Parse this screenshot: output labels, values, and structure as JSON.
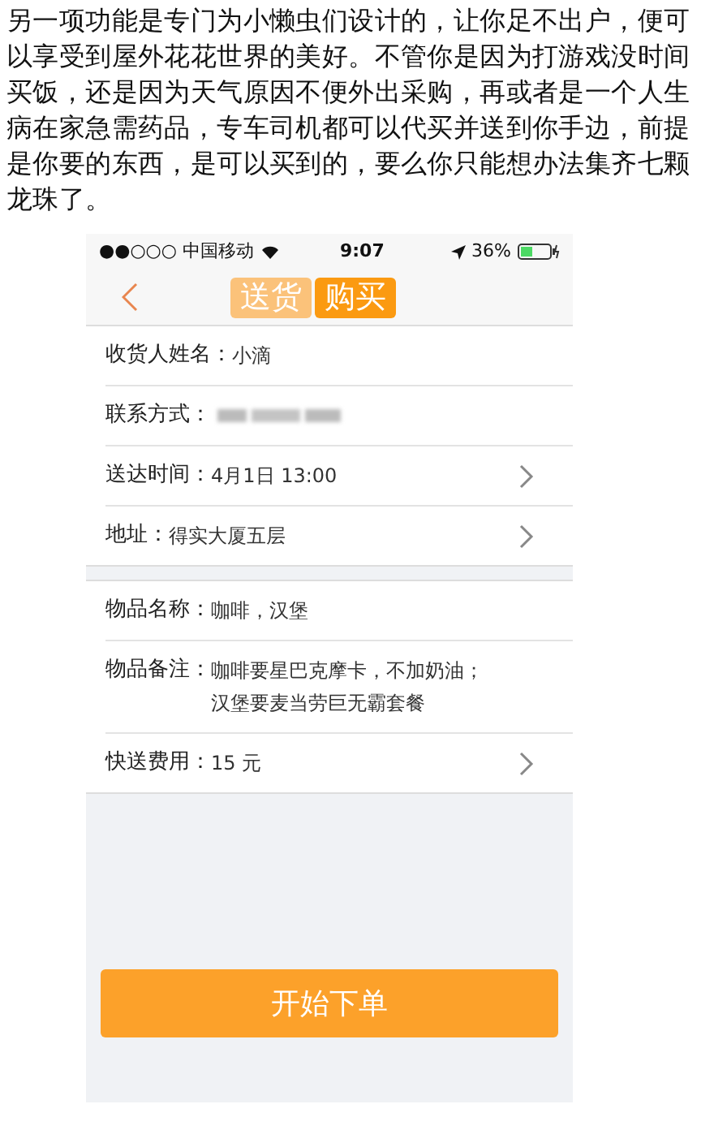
{
  "article": {
    "text": "另一项功能是专门为小懒虫们设计的，让你足不出户，便可以享受到屋外花花世界的美好。不管你是因为打游戏没时间买饭，还是因为天气原因不便外出采购，再或者是一个人生病在家急需药品，专车司机都可以代买并送到你手边，前提是你要的东西，是可以买到的，要么你只能想办法集齐七颗龙珠了。"
  },
  "status_bar": {
    "carrier": "●●○○○ 中国移动",
    "time": "9:07",
    "battery": "36%"
  },
  "tabs": [
    {
      "label": "送货",
      "selected": false
    },
    {
      "label": "购买",
      "selected": true
    }
  ],
  "sections": [
    {
      "rows": [
        {
          "label": "收货人姓名：",
          "value": "小滴",
          "blurred": false,
          "arrow": false
        },
        {
          "label": "联系方式：",
          "blurred": true,
          "arrow": false
        },
        {
          "label": "送达时间：",
          "value": "4月1日 13:00",
          "blurred": false,
          "arrow": true
        },
        {
          "label": "地址：",
          "value": "得实大厦五层",
          "blurred": false,
          "arrow": true
        }
      ]
    },
    {
      "rows": [
        {
          "label": "物品名称：",
          "value": "咖啡，汉堡",
          "blurred": false,
          "arrow": false
        },
        {
          "label": "物品备注：",
          "lines": [
            "咖啡要星巴克摩卡，不加奶油；",
            "汉堡要麦当劳巨无霸套餐"
          ],
          "blurred": false,
          "arrow": false
        },
        {
          "label": "快送费用：",
          "value": "15 元",
          "blurred": false,
          "arrow": true
        }
      ]
    }
  ],
  "submit_button": "开始下单"
}
